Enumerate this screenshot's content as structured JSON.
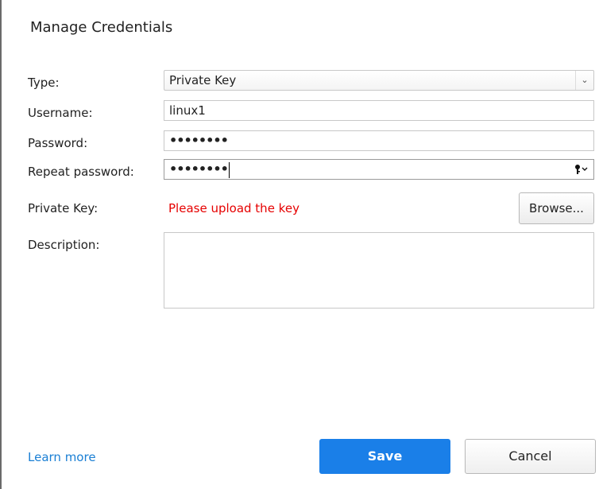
{
  "dialog": {
    "title": "Manage Credentials"
  },
  "form": {
    "type": {
      "label": "Type:",
      "value": "Private Key"
    },
    "username": {
      "label": "Username:",
      "value": "linux1"
    },
    "password": {
      "label": "Password:",
      "value": "••••••••"
    },
    "repeat_password": {
      "label": "Repeat password:",
      "value": "••••••••"
    },
    "private_key": {
      "label": "Private Key:",
      "error": "Please upload the key",
      "browse_label": "Browse..."
    },
    "description": {
      "label": "Description:",
      "value": ""
    }
  },
  "footer": {
    "learn_more": "Learn more",
    "save_label": "Save",
    "cancel_label": "Cancel"
  },
  "icons": {
    "select_arrow": "chevron-down-icon",
    "password_key": "key-icon"
  }
}
